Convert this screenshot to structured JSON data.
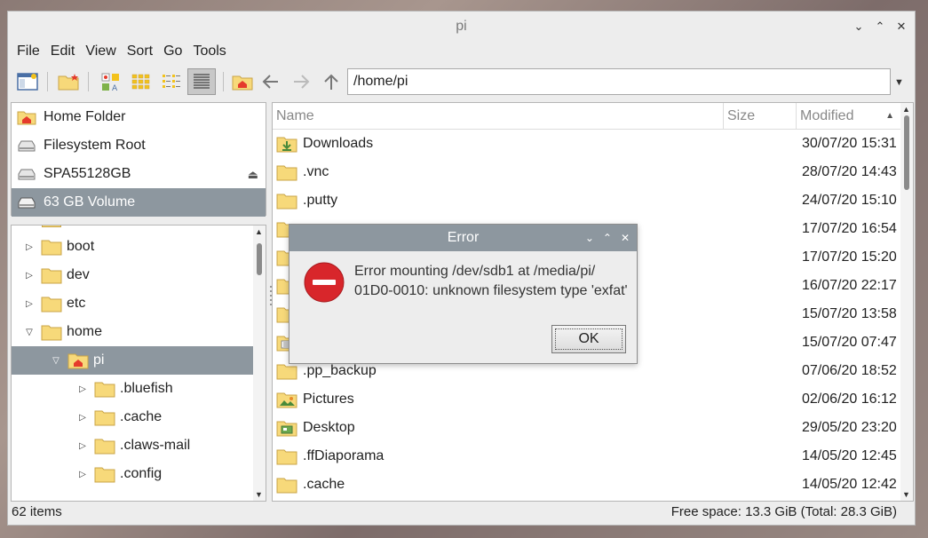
{
  "window": {
    "title": "pi",
    "controls": [
      "⌄",
      "⌃",
      "✕"
    ]
  },
  "menu": [
    "File",
    "Edit",
    "View",
    "Sort",
    "Go",
    "Tools"
  ],
  "toolbar": {
    "path": "/home/pi"
  },
  "places": [
    {
      "label": "Home Folder",
      "icon": "home-folder-icon"
    },
    {
      "label": "Filesystem Root",
      "icon": "drive-icon"
    },
    {
      "label": "SPA55128GB",
      "icon": "drive-icon",
      "eject": "⏏"
    },
    {
      "label": "63 GB Volume",
      "icon": "drive-icon",
      "selected": true
    }
  ],
  "tree": [
    {
      "label": "boot",
      "indent": 0,
      "arrow": "▷"
    },
    {
      "label": "dev",
      "indent": 0,
      "arrow": "▷"
    },
    {
      "label": "etc",
      "indent": 0,
      "arrow": "▷"
    },
    {
      "label": "home",
      "indent": 0,
      "arrow": "▽"
    },
    {
      "label": "pi",
      "indent": 1,
      "arrow": "▽",
      "selected": true,
      "home": true
    },
    {
      "label": ".bluefish",
      "indent": 2,
      "arrow": "▷"
    },
    {
      "label": ".cache",
      "indent": 2,
      "arrow": "▷"
    },
    {
      "label": ".claws-mail",
      "indent": 2,
      "arrow": "▷"
    },
    {
      "label": ".config",
      "indent": 2,
      "arrow": "▷"
    }
  ],
  "columns": {
    "name": "Name",
    "size": "Size",
    "modified": "Modified",
    "sort_arrow": "▲"
  },
  "files": [
    {
      "name": "Downloads",
      "modified": "30/07/20 15:31",
      "icon": "downloads-folder-icon"
    },
    {
      "name": ".vnc",
      "modified": "28/07/20 14:43",
      "icon": "folder-icon"
    },
    {
      "name": ".putty",
      "modified": "24/07/20 15:10",
      "icon": "folder-icon"
    },
    {
      "name": "",
      "modified": "17/07/20 16:54",
      "icon": "folder-icon"
    },
    {
      "name": "",
      "modified": "17/07/20 15:20",
      "icon": "folder-icon"
    },
    {
      "name": "",
      "modified": "16/07/20 22:17",
      "icon": "folder-icon"
    },
    {
      "name": "",
      "modified": "15/07/20 13:58",
      "icon": "folder-icon"
    },
    {
      "name": "",
      "modified": "15/07/20 07:47",
      "icon": "documents-folder-icon"
    },
    {
      "name": ".pp_backup",
      "modified": "07/06/20 18:52",
      "icon": "folder-icon"
    },
    {
      "name": "Pictures",
      "modified": "02/06/20 16:12",
      "icon": "pictures-folder-icon"
    },
    {
      "name": "Desktop",
      "modified": "29/05/20 23:20",
      "icon": "desktop-folder-icon"
    },
    {
      "name": ".ffDiaporama",
      "modified": "14/05/20 12:45",
      "icon": "folder-icon"
    },
    {
      "name": ".cache",
      "modified": "14/05/20 12:42",
      "icon": "folder-icon"
    }
  ],
  "status": {
    "items": "62 items",
    "free": "Free space: 13.3 GiB (Total: 28.3 GiB)"
  },
  "dialog": {
    "title": "Error",
    "message_line1": "Error mounting /dev/sdb1 at /media/pi/",
    "message_line2": "01D0-0010: unknown filesystem type 'exfat'",
    "ok_label": "OK",
    "controls": [
      "⌄",
      "⌃",
      "✕"
    ]
  },
  "colors": {
    "selection": "#8d979f",
    "folder": "#f7d97a",
    "error": "#d8262b"
  }
}
